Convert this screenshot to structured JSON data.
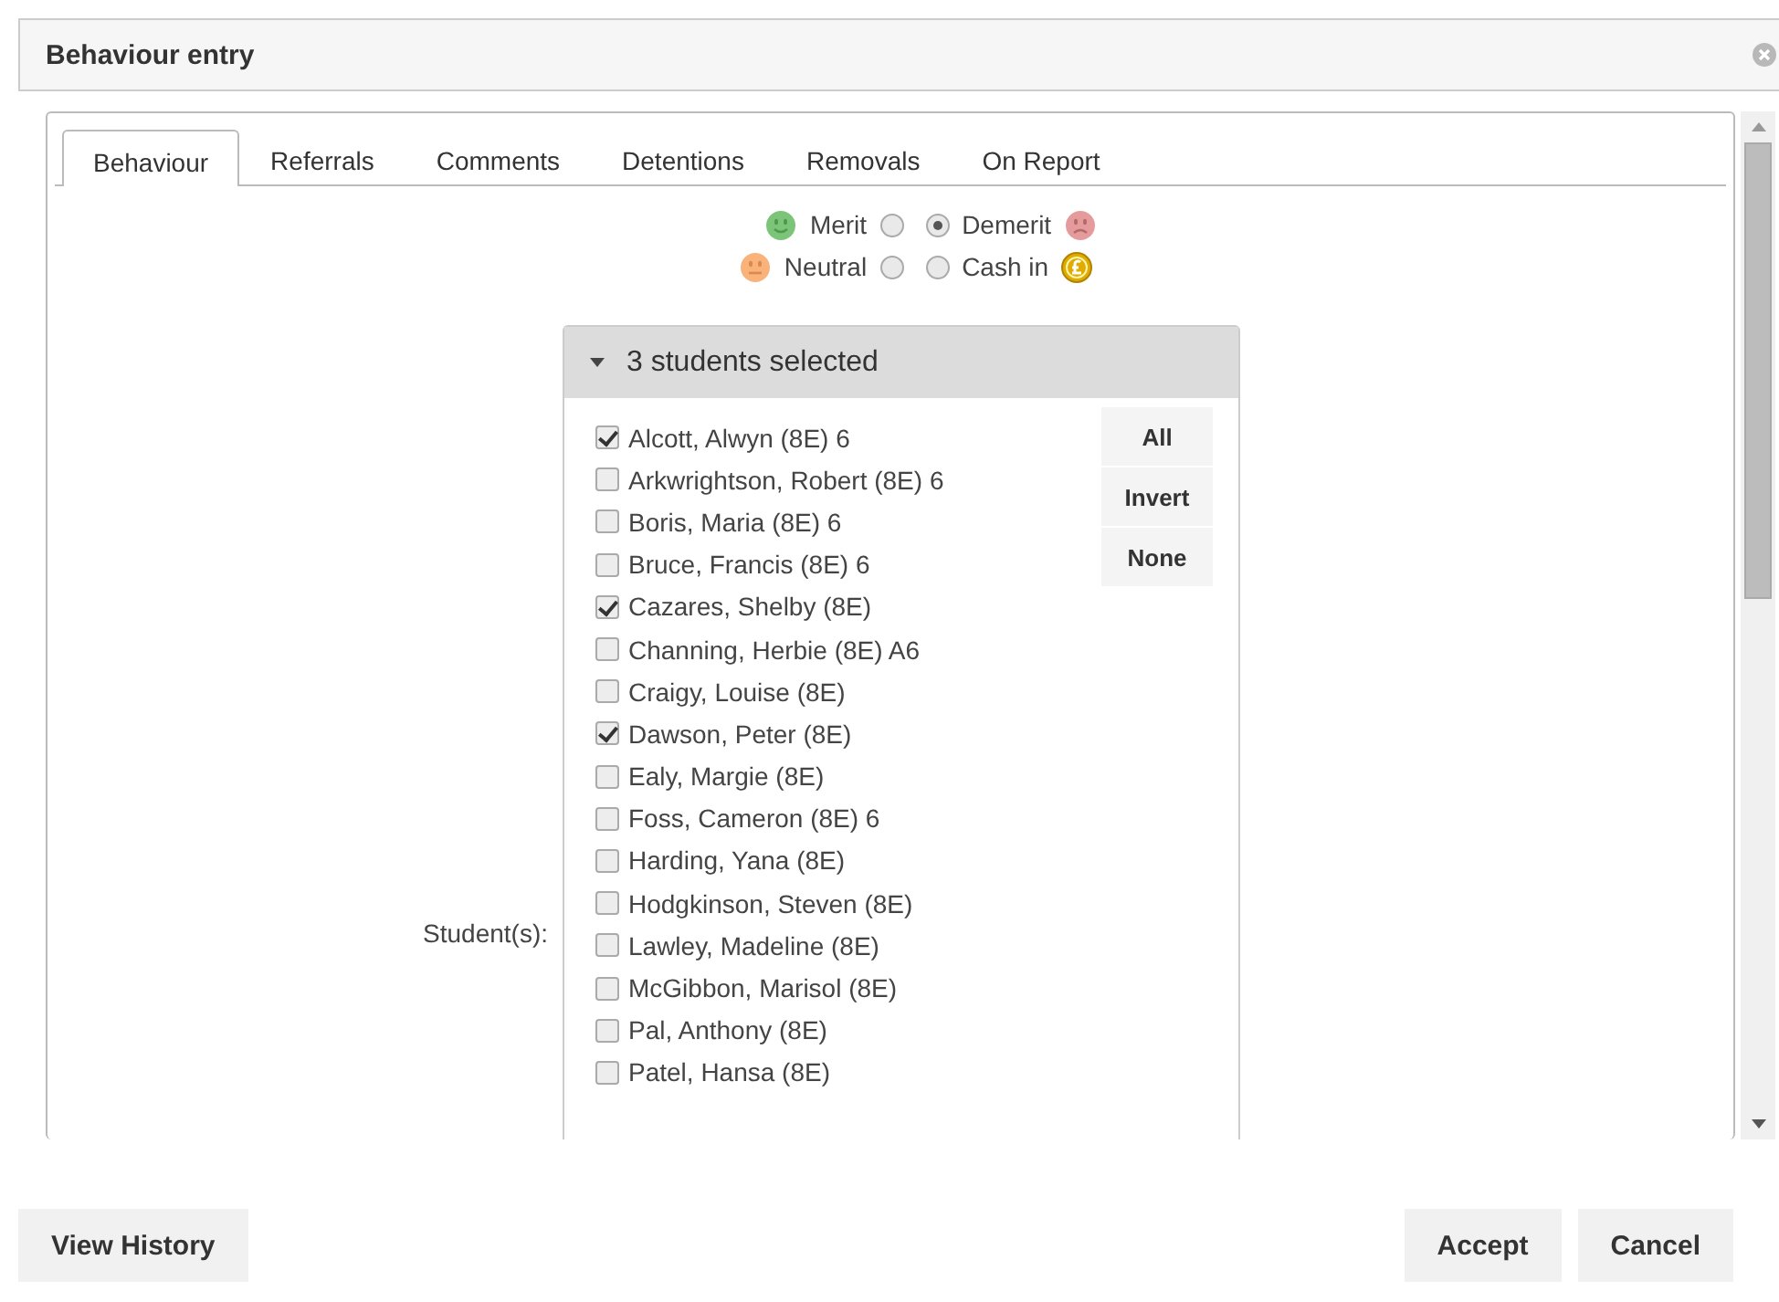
{
  "dialog": {
    "title": "Behaviour entry"
  },
  "tabs": [
    {
      "label": "Behaviour",
      "selected": true
    },
    {
      "label": "Referrals",
      "selected": false
    },
    {
      "label": "Comments",
      "selected": false
    },
    {
      "label": "Detentions",
      "selected": false
    },
    {
      "label": "Removals",
      "selected": false
    },
    {
      "label": "On Report",
      "selected": false
    }
  ],
  "types": [
    {
      "label": "Merit",
      "kind": "merit",
      "selected": false
    },
    {
      "label": "Demerit",
      "kind": "demerit",
      "selected": true
    },
    {
      "label": "Neutral",
      "kind": "neutral",
      "selected": false
    },
    {
      "label": "Cash in",
      "kind": "cashin",
      "selected": false
    }
  ],
  "students": {
    "label": "Student(s):",
    "summary": "3 students selected",
    "buttons": [
      "All",
      "Invert",
      "None"
    ],
    "items": [
      {
        "name": "Alcott, Alwyn (8E) 6",
        "checked": true
      },
      {
        "name": "Arkwrightson, Robert (8E) 6",
        "checked": false
      },
      {
        "name": "Boris, Maria (8E) 6",
        "checked": false
      },
      {
        "name": "Bruce, Francis (8E) 6",
        "checked": false
      },
      {
        "name": "Cazares, Shelby (8E)",
        "checked": true
      },
      {
        "name": "Channing, Herbie (8E) A6",
        "checked": false
      },
      {
        "name": "Craigy, Louise (8E)",
        "checked": false
      },
      {
        "name": "Dawson, Peter (8E)",
        "checked": true
      },
      {
        "name": "Ealy, Margie (8E)",
        "checked": false
      },
      {
        "name": "Foss, Cameron (8E) 6",
        "checked": false
      },
      {
        "name": "Harding, Yana (8E)",
        "checked": false
      },
      {
        "name": "Hodgkinson, Steven (8E)",
        "checked": false
      },
      {
        "name": "Lawley, Madeline (8E)",
        "checked": false
      },
      {
        "name": "McGibbon, Marisol (8E)",
        "checked": false
      },
      {
        "name": "Pal, Anthony (8E)",
        "checked": false
      },
      {
        "name": "Patel, Hansa (8E)",
        "checked": false
      }
    ]
  },
  "footer": {
    "left_buttons": [
      "View History"
    ],
    "right_buttons": [
      "Accept",
      "Cancel"
    ]
  }
}
